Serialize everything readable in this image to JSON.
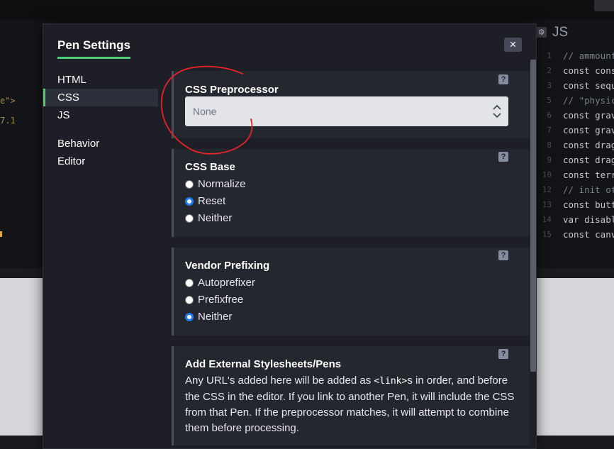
{
  "background": {
    "left_code": [
      "e\">",
      "7.1"
    ],
    "js_panel": {
      "title": "JS",
      "line_numbers": [
        "1",
        "2",
        "3",
        "",
        "5",
        "6",
        "7",
        "8",
        "9",
        "10",
        "",
        "12",
        "13",
        "14",
        "15"
      ],
      "lines": [
        {
          "text": "// ammount",
          "kind": "comment"
        },
        {
          "text": "const cons",
          "kind": "code"
        },
        {
          "text": "const sequ",
          "kind": "code"
        },
        {
          "text": "",
          "kind": "code"
        },
        {
          "text": "// \"physic",
          "kind": "comment"
        },
        {
          "text": "const grav",
          "kind": "code"
        },
        {
          "text": "const grav",
          "kind": "code"
        },
        {
          "text": "const drag",
          "kind": "code"
        },
        {
          "text": "const drag",
          "kind": "code"
        },
        {
          "text": "const terr",
          "kind": "code"
        },
        {
          "text": "",
          "kind": "code"
        },
        {
          "text": "// init ot",
          "kind": "comment"
        },
        {
          "text": "const butt",
          "kind": "code"
        },
        {
          "text": "var disabl",
          "kind": "code"
        },
        {
          "text": "const canv",
          "kind": "code"
        }
      ]
    }
  },
  "modal": {
    "title": "Pen Settings",
    "close_label": "×",
    "nav": [
      {
        "label": "HTML",
        "active": false
      },
      {
        "label": "CSS",
        "active": true
      },
      {
        "label": "JS",
        "active": false
      },
      {
        "label": "Behavior",
        "active": false
      },
      {
        "label": "Editor",
        "active": false
      }
    ],
    "help_label": "?",
    "preprocessor": {
      "title": "CSS Preprocessor",
      "value": "None"
    },
    "css_base": {
      "title": "CSS Base",
      "options": [
        {
          "label": "Normalize",
          "checked": false
        },
        {
          "label": "Reset",
          "checked": true
        },
        {
          "label": "Neither",
          "checked": false
        }
      ]
    },
    "vendor_prefixing": {
      "title": "Vendor Prefixing",
      "options": [
        {
          "label": "Autoprefixer",
          "checked": false
        },
        {
          "label": "Prefixfree",
          "checked": false
        },
        {
          "label": "Neither",
          "checked": true
        }
      ]
    },
    "external": {
      "title": "Add External Stylesheets/Pens",
      "desc_before": "Any URL's added here will be added as ",
      "desc_code": "<link>",
      "desc_after": "s in order, and before the CSS in the editor. If you link to another Pen, it will include the CSS from that Pen. If the preprocessor matches, it will attempt to combine them before processing."
    }
  },
  "colors": {
    "accent_green": "#47cf73",
    "radio_blue": "#1f7cf0",
    "annotation_red": "#e8232a"
  }
}
